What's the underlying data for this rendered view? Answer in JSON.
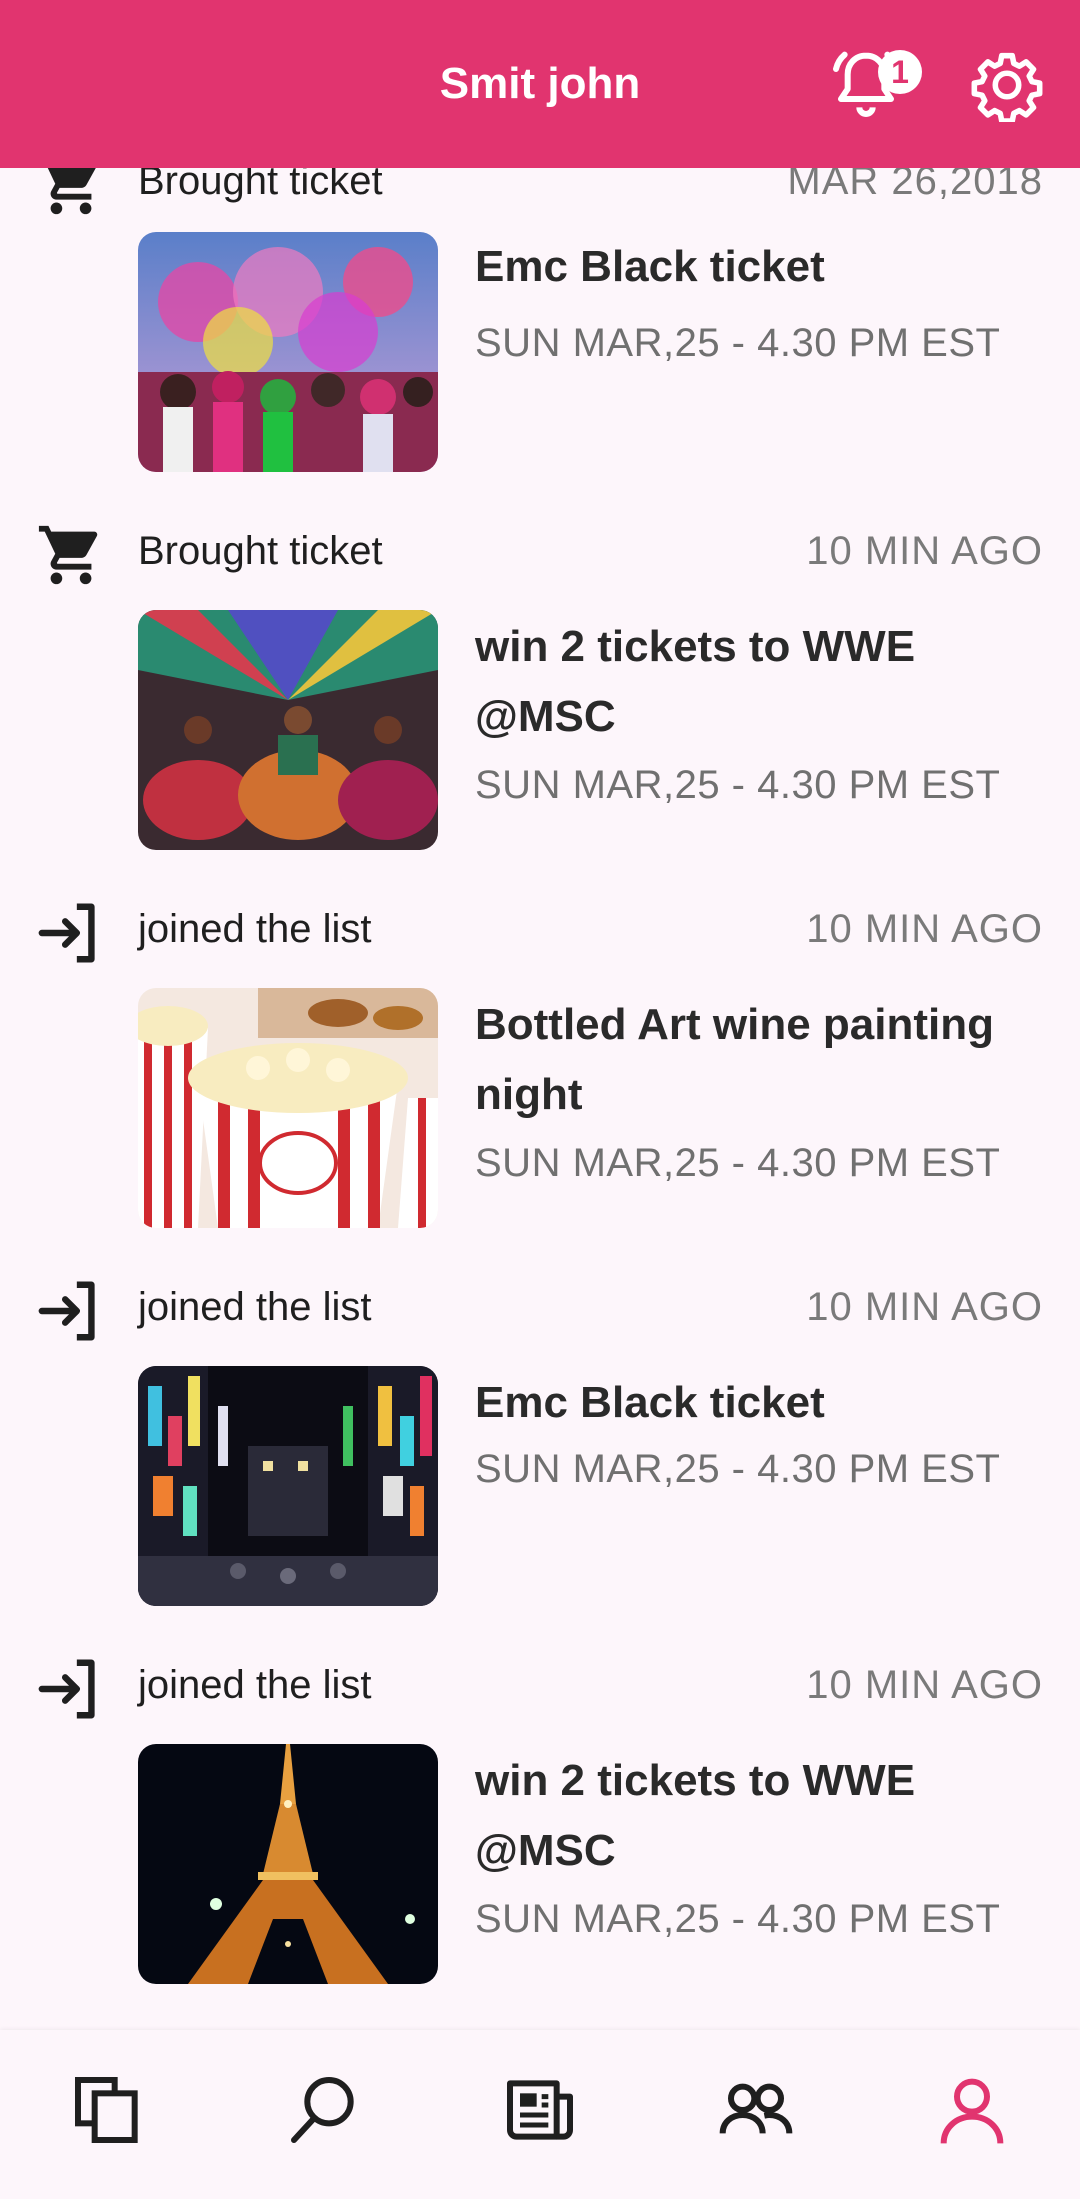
{
  "header": {
    "title": "Smit john",
    "notification_count": "1",
    "accent_color": "#e1346f"
  },
  "feed": [
    {
      "action": "Brought ticket",
      "time": "MAR 26,2018",
      "icon": "cart-icon",
      "title": "Emc Black ticket",
      "date": "SUN MAR,25 - 4.30 PM EST",
      "image": "holi-festival-crowd-image"
    },
    {
      "action": "Brought ticket",
      "time": "10 MIN AGO",
      "icon": "cart-icon",
      "title": "win 2 tickets to WWE @MSC",
      "date": "SUN MAR,25 - 4.30 PM EST",
      "image": "garba-dancers-image"
    },
    {
      "action": "joined the list",
      "time": "10 MIN AGO",
      "icon": "login-arrow-icon",
      "title": "Bottled Art wine painting night",
      "date": "SUN MAR,25 - 4.30 PM EST",
      "image": "popcorn-boxes-image"
    },
    {
      "action": "joined the list",
      "time": "10 MIN AGO",
      "icon": "login-arrow-icon",
      "title": "Emc Black ticket",
      "date": "SUN MAR,25 - 4.30 PM EST",
      "image": "night-city-street-image"
    },
    {
      "action": "joined the list",
      "time": "10 MIN AGO",
      "icon": "login-arrow-icon",
      "title": "win 2 tickets to WWE @MSC",
      "date": "SUN MAR,25 - 4.30 PM EST",
      "image": "eiffel-tower-night-image"
    }
  ],
  "bottom_nav": [
    {
      "icon": "copy-pages-icon",
      "active": false
    },
    {
      "icon": "search-icon",
      "active": false
    },
    {
      "icon": "newspaper-icon",
      "active": false
    },
    {
      "icon": "people-icon",
      "active": false
    },
    {
      "icon": "profile-icon",
      "active": true
    }
  ]
}
